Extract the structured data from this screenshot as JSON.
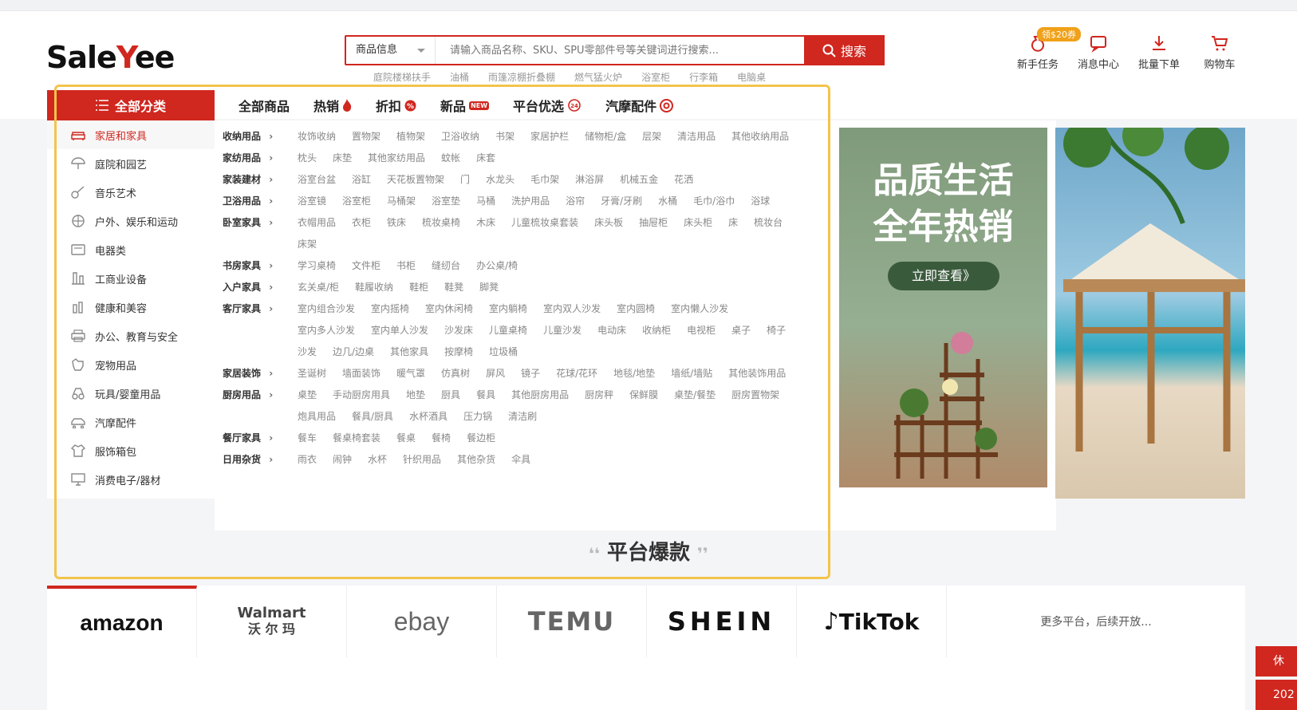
{
  "logo": {
    "text_a": "Sale",
    "text_y": "Y",
    "text_b": "ee"
  },
  "search": {
    "scope": "商品信息",
    "placeholder": "请输入商品名称、SKU、SPU零部件号等关键词进行搜索...",
    "button": "搜索"
  },
  "hot_keywords": [
    "庭院楼梯扶手",
    "油桶",
    "雨篷凉棚折叠棚",
    "燃气猛火炉",
    "浴室柜",
    "行李箱",
    "电脑桌"
  ],
  "header_icons": [
    {
      "icon": "moneybag-icon",
      "label": "新手任务",
      "badge": "领$20券"
    },
    {
      "icon": "message-icon",
      "label": "消息中心"
    },
    {
      "icon": "download-icon",
      "label": "批量下单"
    },
    {
      "icon": "cart-icon",
      "label": "购物车"
    }
  ],
  "nav": {
    "all_label": "全部分类",
    "items": [
      {
        "label": "全部商品"
      },
      {
        "label": "热销",
        "icon": "fire-icon"
      },
      {
        "label": "折扣",
        "icon": "discount-icon"
      },
      {
        "label": "新品",
        "icon": "new-icon",
        "badge": "NEW"
      },
      {
        "label": "平台优选",
        "icon": "24h-icon"
      },
      {
        "label": "汽摩配件",
        "icon": "wheel-icon"
      }
    ]
  },
  "categories": [
    "家居和家具",
    "庭院和园艺",
    "音乐艺术",
    "户外、娱乐和运动",
    "电器类",
    "工商业设备",
    "健康和美容",
    "办公、教育与安全",
    "宠物用品",
    "玩具/婴童用品",
    "汽摩配件",
    "服饰箱包",
    "消费电子/器材"
  ],
  "subcategories": [
    {
      "h": "收纳用品",
      "items": [
        "妆饰收纳",
        "置物架",
        "植物架",
        "卫浴收纳",
        "书架",
        "家居护栏",
        "储物柜/盒",
        "层架",
        "清洁用品",
        "其他收纳用品"
      ]
    },
    {
      "h": "家纺用品",
      "items": [
        "枕头",
        "床垫",
        "其他家纺用品",
        "蚊帐",
        "床套"
      ]
    },
    {
      "h": "家装建材",
      "items": [
        "浴室台盆",
        "浴缸",
        "天花板置物架",
        "门",
        "水龙头",
        "毛巾架",
        "淋浴屏",
        "机械五金",
        "花洒"
      ]
    },
    {
      "h": "卫浴用品",
      "items": [
        "浴室镜",
        "浴室柜",
        "马桶架",
        "浴室垫",
        "马桶",
        "洗护用品",
        "浴帘",
        "牙膏/牙刷",
        "水桶",
        "毛巾/浴巾",
        "浴球"
      ]
    },
    {
      "h": "卧室家具",
      "items": [
        "衣帽用品",
        "衣柜",
        "铁床",
        "梳妆桌椅",
        "木床",
        "儿童梳妆桌套装",
        "床头板",
        "抽屉柜",
        "床头柜",
        "床",
        "梳妆台",
        "床架"
      ]
    },
    {
      "h": "书房家具",
      "items": [
        "学习桌椅",
        "文件柜",
        "书柜",
        "缝纫台",
        "办公桌/椅"
      ]
    },
    {
      "h": "入户家具",
      "items": [
        "玄关桌/柜",
        "鞋履收纳",
        "鞋柜",
        "鞋凳",
        "脚凳"
      ]
    },
    {
      "h": "客厅家具",
      "items": [
        "室内组合沙发",
        "室内摇椅",
        "室内休闲椅",
        "室内躺椅",
        "室内双人沙发",
        "室内圆椅",
        "室内懒人沙发",
        "室内多人沙发",
        "室内单人沙发",
        "沙发床",
        "儿童桌椅",
        "儿童沙发",
        "电动床",
        "收纳柜",
        "电视柜",
        "桌子",
        "椅子",
        "沙发",
        "边几/边桌",
        "其他家具",
        "按摩椅",
        "垃圾桶"
      ]
    },
    {
      "h": "家居装饰",
      "items": [
        "圣诞树",
        "墙面装饰",
        "暖气罩",
        "仿真树",
        "屏风",
        "镜子",
        "花球/花环",
        "地毯/地垫",
        "墙纸/墙贴",
        "其他装饰用品"
      ]
    },
    {
      "h": "厨房用品",
      "items": [
        "桌垫",
        "手动厨房用具",
        "地垫",
        "厨具",
        "餐具",
        "其他厨房用品",
        "厨房秤",
        "保鲜膜",
        "桌垫/餐垫",
        "厨房置物架",
        "炮具用品",
        "餐具/厨具",
        "水杯酒具",
        "压力锅",
        "清洁刷"
      ]
    },
    {
      "h": "餐厅家具",
      "items": [
        "餐车",
        "餐桌椅套装",
        "餐桌",
        "餐椅",
        "餐边柜"
      ]
    },
    {
      "h": "日用杂货",
      "items": [
        "雨衣",
        "闹钟",
        "水杯",
        "针织用品",
        "其他杂货",
        "伞具"
      ]
    }
  ],
  "banner1": {
    "line1": "品质生活",
    "line2": "全年热销",
    "button": "立即查看》"
  },
  "section_title": "平台爆款",
  "platforms": [
    "amazon",
    "Walmart",
    "沃 尔 玛",
    "ebay",
    "TEMU",
    "SHEIN",
    "TikTok"
  ],
  "platforms_more": "更多平台，后续开放...",
  "side_tabs": [
    "休",
    "202"
  ],
  "colors": {
    "brand": "#d0271f",
    "highlight": "#f3c44c"
  }
}
